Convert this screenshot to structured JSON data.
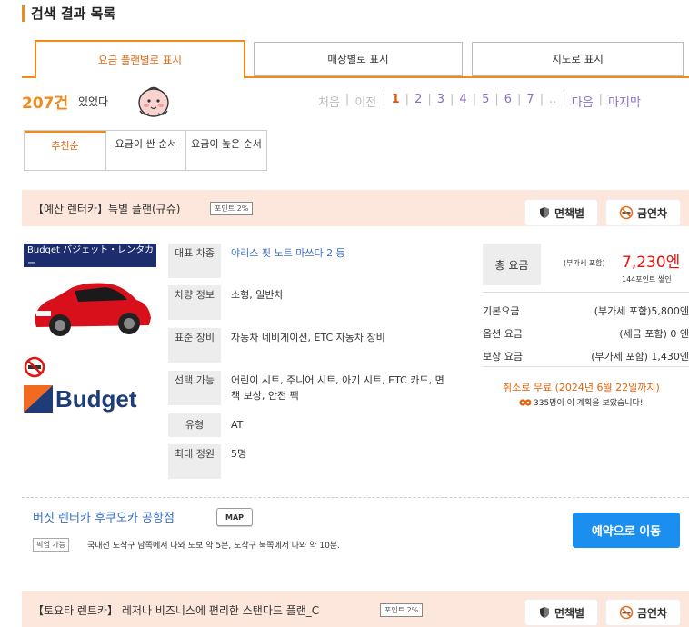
{
  "page": {
    "title": "검색 결과 목록"
  },
  "tabs": [
    {
      "label": "요금 플랜별로 표시"
    },
    {
      "label": "매장별로 표시"
    },
    {
      "label": "지도로 표시"
    }
  ],
  "results": {
    "count": "207건",
    "suffix": "있었다"
  },
  "pager": {
    "first": "처음",
    "prev": "이전",
    "pages": [
      "1",
      "2",
      "3",
      "4",
      "5",
      "6",
      "7"
    ],
    "ellipsis": "..",
    "next": "다음",
    "last": "마지막",
    "current": "1"
  },
  "sort": [
    {
      "label": "추천순"
    },
    {
      "label": "요금이 싼 순서"
    },
    {
      "label": "요금이 높은 순서"
    }
  ],
  "plans": [
    {
      "name": "【예산 렌터카】특별 플랜(규슈)",
      "points_badge": "포인트 2%",
      "insurance_label": "면책별",
      "nosmoking_label": "금연차",
      "vendor_banner": "Budget バジェット・レンタカー",
      "vendor_logo": "Budget",
      "specs": [
        {
          "label": "대표 차종",
          "value": "야리스 핏 노트 마쓰다 2 등"
        },
        {
          "label": "차량 정보",
          "value": "소형, 일반차"
        },
        {
          "label": "표준 장비",
          "value": "자동차 네비게이션, ETC 자동차 장비"
        },
        {
          "label": "선택 가능",
          "value": "어린이 시트, 주니어 시트, 아기 시트, ETC 카드, 면책 보상, 안전 팩"
        },
        {
          "label": "유형",
          "value": "AT"
        },
        {
          "label": "최대 정원",
          "value": "5명"
        }
      ],
      "price": {
        "total_label": "총 요금",
        "tax_note": "(부가세 포함)",
        "total": "7,230엔",
        "points": "144포인트 쌓인",
        "rows": [
          {
            "label": "기본요금",
            "value": "(부가세 포함)5,800엔"
          },
          {
            "label": "옵션 요금",
            "value": "(세금 포함) 0 엔"
          },
          {
            "label": "보상 요금",
            "value": "(부가세 포함) 1,430엔"
          }
        ],
        "cancel": "취소료 무료 (2024년 6월 22일까지)",
        "viewed": "335명이 이 계획을 보았습니다!"
      },
      "store": {
        "name": "버짓 렌터카 후쿠오카 공항점",
        "map_label": "MAP",
        "pickup_badge": "픽업 가능",
        "pickup_text": "국내선 도착구 남쪽에서 나와 도보 약 5분, 도착구 북쪽에서 나와 약 10분."
      },
      "reserve_label": "예약으로 이동"
    },
    {
      "name": "【토요타 렌트카】 레저나 비즈니스에 편리한 스탠다드 플랜_C",
      "points_badge": "포인트 2%",
      "insurance_label": "면책별",
      "nosmoking_label": "금연차"
    }
  ],
  "colors": {
    "accent": "#f08a1c",
    "price": "#e3140e",
    "link": "#3a6ec7",
    "reserve": "#1b8ff0",
    "plan_header": "#fde7dc"
  }
}
